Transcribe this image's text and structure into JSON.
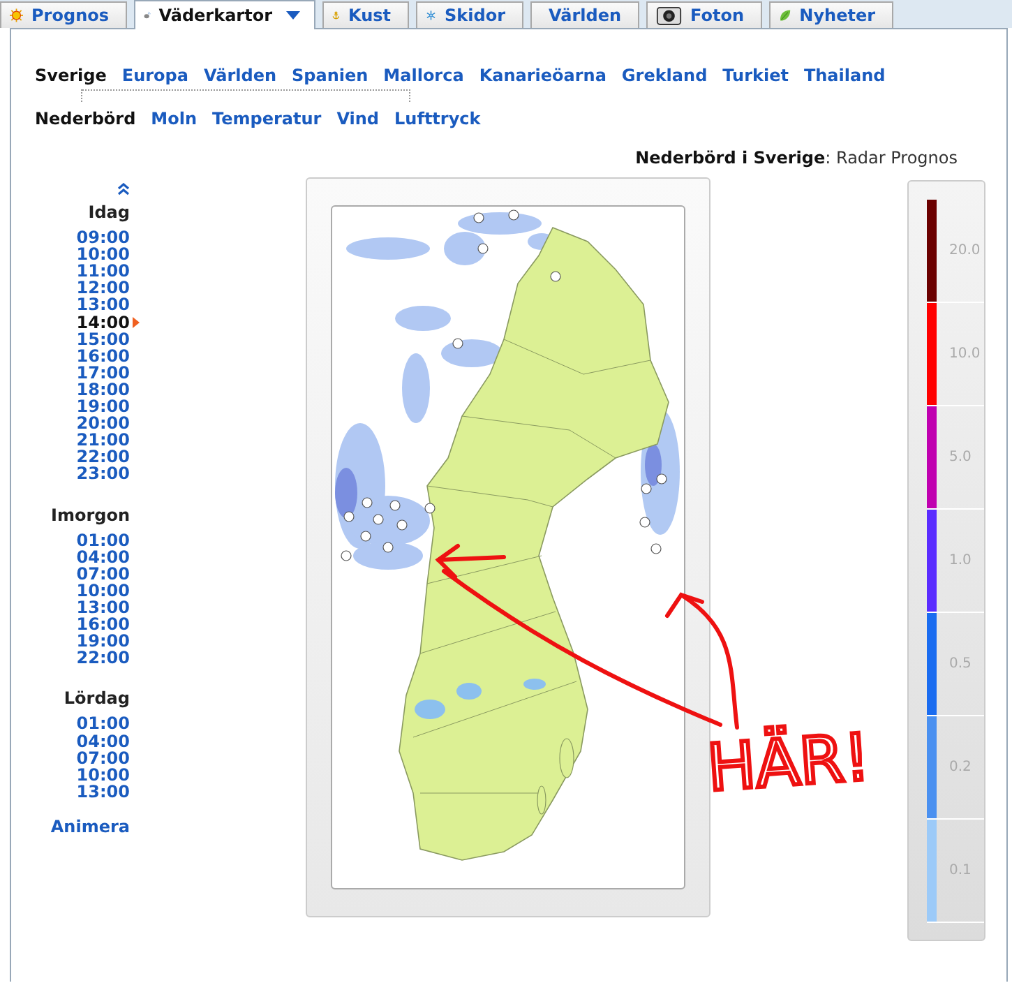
{
  "tabs": [
    {
      "label": "Prognos",
      "selected": false
    },
    {
      "label": "Väderkartor",
      "selected": true,
      "dropdown": true
    },
    {
      "label": "Kust",
      "selected": false
    },
    {
      "label": "Skidor",
      "selected": false
    },
    {
      "label": "Världen",
      "selected": false
    },
    {
      "label": "Foton",
      "selected": false
    },
    {
      "label": "Nyheter",
      "selected": false
    }
  ],
  "regions": [
    {
      "label": "Sverige",
      "selected": true
    },
    {
      "label": "Europa",
      "selected": false
    },
    {
      "label": "Världen",
      "selected": false
    },
    {
      "label": "Spanien",
      "selected": false
    },
    {
      "label": "Mallorca",
      "selected": false
    },
    {
      "label": "Kanarieöarna",
      "selected": false
    },
    {
      "label": "Grekland",
      "selected": false
    },
    {
      "label": "Turkiet",
      "selected": false
    },
    {
      "label": "Thailand",
      "selected": false
    }
  ],
  "map_types": [
    {
      "label": "Nederbörd",
      "selected": true
    },
    {
      "label": "Moln",
      "selected": false
    },
    {
      "label": "Temperatur",
      "selected": false
    },
    {
      "label": "Vind",
      "selected": false
    },
    {
      "label": "Lufttryck",
      "selected": false
    }
  ],
  "map_title": "**Nederbörd i Sverige**: Radar Prognos",
  "timeline": {
    "days": [
      {
        "day": "Idag",
        "times": [
          {
            "label": "09:00",
            "selected": false
          },
          {
            "label": "10:00",
            "selected": false
          },
          {
            "label": "11:00",
            "selected": false
          },
          {
            "label": "12:00",
            "selected": false
          },
          {
            "label": "13:00",
            "selected": false
          },
          {
            "label": "14:00",
            "selected": true
          },
          {
            "label": "15:00",
            "selected": false
          },
          {
            "label": "16:00",
            "selected": false
          },
          {
            "label": "17:00",
            "selected": false
          },
          {
            "label": "18:00",
            "selected": false
          },
          {
            "label": "19:00",
            "selected": false
          },
          {
            "label": "20:00",
            "selected": false
          },
          {
            "label": "21:00",
            "selected": false
          },
          {
            "label": "22:00",
            "selected": false
          },
          {
            "label": "23:00",
            "selected": false
          }
        ]
      },
      {
        "day": "Imorgon",
        "times": [
          {
            "label": "01:00",
            "selected": false
          },
          {
            "label": "04:00",
            "selected": false
          },
          {
            "label": "07:00",
            "selected": false
          },
          {
            "label": "10:00",
            "selected": false
          },
          {
            "label": "13:00",
            "selected": false
          },
          {
            "label": "16:00",
            "selected": false
          },
          {
            "label": "19:00",
            "selected": false
          },
          {
            "label": "22:00",
            "selected": false
          }
        ]
      },
      {
        "day": "Lördag",
        "times": [
          {
            "label": "01:00",
            "selected": false
          },
          {
            "label": "04:00",
            "selected": false
          },
          {
            "label": "07:00",
            "selected": false
          },
          {
            "label": "10:00",
            "selected": false
          },
          {
            "label": "13:00",
            "selected": false
          }
        ]
      }
    ],
    "animate": "Animera"
  },
  "legend": [
    {
      "label": "20.0",
      "color": "#6b0000"
    },
    {
      "label": "10.0",
      "color": "#ff0000"
    },
    {
      "label": "5.0",
      "color": "#c000b0"
    },
    {
      "label": "1.0",
      "color": "#5a2cff"
    },
    {
      "label": "0.5",
      "color": "#1a6cf0"
    },
    {
      "label": "0.2",
      "color": "#4a90f0"
    },
    {
      "label": "0.1",
      "color": "#9ccaf8"
    }
  ],
  "annotation": "HÄR!"
}
